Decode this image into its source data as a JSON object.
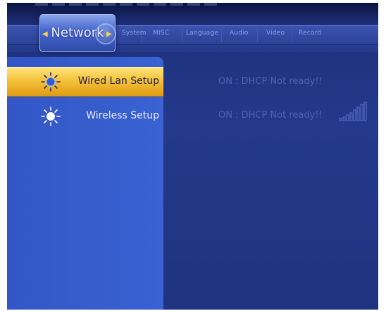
{
  "header": {
    "active_tab": "Network",
    "tabs": [
      {
        "id": "system",
        "label": "System"
      },
      {
        "id": "misc",
        "label": "MISC"
      },
      {
        "id": "language",
        "label": "Language"
      },
      {
        "id": "audio",
        "label": "Audio"
      },
      {
        "id": "video",
        "label": "Video"
      },
      {
        "id": "record",
        "label": "Record"
      }
    ]
  },
  "menu": {
    "items": [
      {
        "label": "Wired Lan Setup",
        "status": "ON : DHCP Not ready!!",
        "selected": true,
        "icon": "sun-icon"
      },
      {
        "label": "Wireless Setup",
        "status": "ON : DHCP Not ready!!",
        "selected": false,
        "icon": "sun-icon"
      }
    ]
  },
  "wireless": {
    "signal_icon": "signal-bars-icon"
  },
  "colors": {
    "background": "#23398a",
    "panel": "#3a62d2",
    "highlight": "#f5c23a",
    "status_text": "#4d63b2",
    "tab_text": "#8ca0e0"
  }
}
